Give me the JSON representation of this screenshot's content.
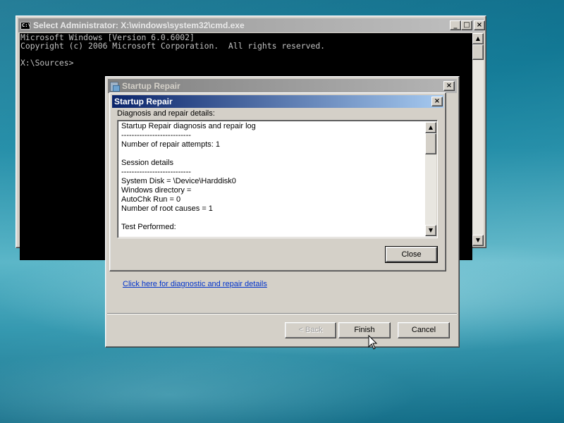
{
  "cmd_window": {
    "title": "Select Administrator: X:\\windows\\system32\\cmd.exe",
    "icon_label": "C:\\",
    "console_lines": [
      "Microsoft Windows [Version 6.0.6002]",
      "Copyright (c) 2006 Microsoft Corporation.  All rights reserved.",
      "",
      "X:\\Sources>"
    ],
    "buttons": {
      "minimize": "_",
      "maximize": "□",
      "close": "×"
    }
  },
  "startup_repair_window": {
    "title": "Startup Repair",
    "close": "×",
    "link_text": "Click here for diagnostic and repair details",
    "back_label": "< Back",
    "finish_label": "Finish",
    "cancel_label": "Cancel"
  },
  "details_dialog": {
    "title": "Startup Repair",
    "close": "×",
    "heading": "Diagnosis and repair details:",
    "log_lines": [
      "Startup Repair diagnosis and repair log",
      "---------------------------",
      "Number of repair attempts: 1",
      "",
      "Session details",
      "---------------------------",
      "System Disk = \\Device\\Harddisk0",
      "Windows directory =",
      "AutoChk Run = 0",
      "Number of root causes = 1",
      "",
      "Test Performed:"
    ],
    "close_button_label": "Close"
  },
  "colors": {
    "active_title_start": "#0a246a",
    "active_title_end": "#a6caf0",
    "link": "#0033cc",
    "console_text": "#c0c0c0"
  }
}
